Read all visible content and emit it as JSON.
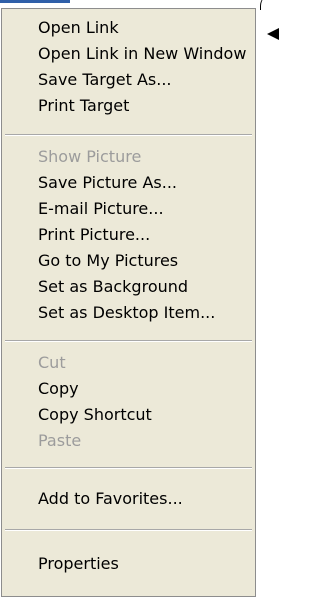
{
  "menu": {
    "group1": [
      {
        "label": "Open Link",
        "enabled": true
      },
      {
        "label": "Open Link in New Window",
        "enabled": true
      },
      {
        "label": "Save Target As...",
        "enabled": true
      },
      {
        "label": "Print Target",
        "enabled": true
      }
    ],
    "group2": [
      {
        "label": "Show Picture",
        "enabled": false
      },
      {
        "label": "Save Picture As...",
        "enabled": true
      },
      {
        "label": "E-mail Picture...",
        "enabled": true
      },
      {
        "label": "Print Picture...",
        "enabled": true
      },
      {
        "label": "Go to My Pictures",
        "enabled": true
      },
      {
        "label": "Set as Background",
        "enabled": true
      },
      {
        "label": "Set as Desktop Item...",
        "enabled": true
      }
    ],
    "group3": [
      {
        "label": "Cut",
        "enabled": false
      },
      {
        "label": "Copy",
        "enabled": true
      },
      {
        "label": "Copy Shortcut",
        "enabled": true
      },
      {
        "label": "Paste",
        "enabled": false
      }
    ],
    "group4": [
      {
        "label": "Add to Favorites...",
        "enabled": true
      }
    ],
    "group5": [
      {
        "label": "Properties",
        "enabled": true
      }
    ]
  },
  "icons": {
    "pointer": "left-pointing-triangle"
  },
  "colors": {
    "menu_background": "#ece9d8",
    "disabled_text": "#9c9c9c",
    "strip": "#2f5fa8"
  }
}
